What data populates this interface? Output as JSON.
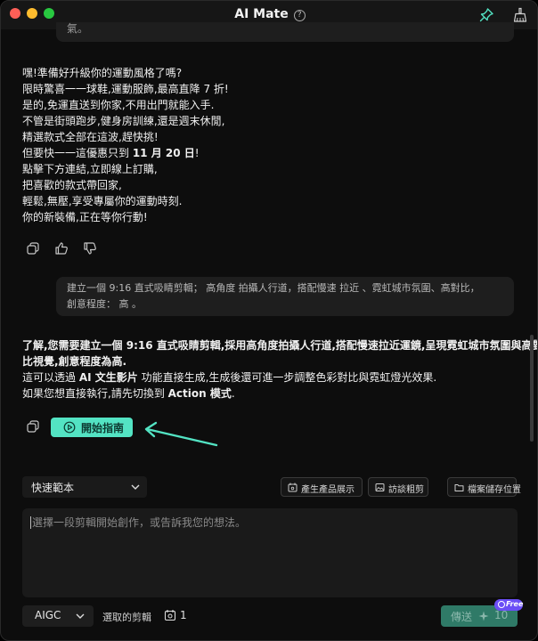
{
  "window": {
    "title": "AI Mate",
    "help_glyph": "?"
  },
  "chat": {
    "previous_fragment": "氣。",
    "ai_message_1": [
      "嘿!準備好升級你的運動風格了嗎?",
      "限時驚喜一一球鞋,運動服飾,最高直降 7 折!",
      "是的,免運直送到你家,不用出門就能入手.",
      "不管是街頭跑步,健身房訓練,還是週末休閒,",
      "精選款式全部在這波,趕快挑!",
      "但要快一一這優惠只到 11 月 20 日!",
      "點擊下方連結,立即線上訂購,",
      "把喜歡的款式帶回家,",
      "輕鬆,無壓,享受專屬你的運動時刻.",
      "你的新裝備,正在等你行動!"
    ],
    "ai_message_1_bold": "11 月 20 日",
    "user_message": {
      "line1": "建立一個 9:16 直式吸睛剪輯； 高角度 拍攝人行道，搭配慢速 拉近 、霓虹城市氛圍、高對比，",
      "line2": "創意程度： 高 。"
    },
    "ai_message_2": {
      "line1": "了解,您需要建立一個 9:16 直式吸睛剪輯,採用高角度拍攝人行道,搭配慢速拉近運鏡,呈現霓虹城市氛圍與高對",
      "line2": "比視覺,創意程度為高.",
      "line3_a": "這可以透過 ",
      "line3_b": "AI 文生影片",
      "line3_c": " 功能直接生成,生成後還可進一步調整色彩對比與霓虹燈光效果.",
      "line4_a": "如果您想直接執行,請先切換到 ",
      "line4_b": "Action 模式",
      "line4_c": "."
    },
    "start_guide_label": "開始指南"
  },
  "toolbar": {
    "template_select": "快速範本",
    "chips": [
      "產生產品展示",
      "訪談粗剪",
      "檔案儲存位置"
    ]
  },
  "input": {
    "placeholder": "選擇一段剪輯開始創作，或告訴我您的想法。"
  },
  "bottom": {
    "mode": "AIGC",
    "selected_label": "選取的剪輯",
    "selected_count": "1",
    "send_label": "傳送",
    "send_cost": "10",
    "free_badge": "Free"
  },
  "colors": {
    "accent": "#53e3c3",
    "send_disabled": "#2f7a67",
    "badge": "#6b4ef6"
  }
}
